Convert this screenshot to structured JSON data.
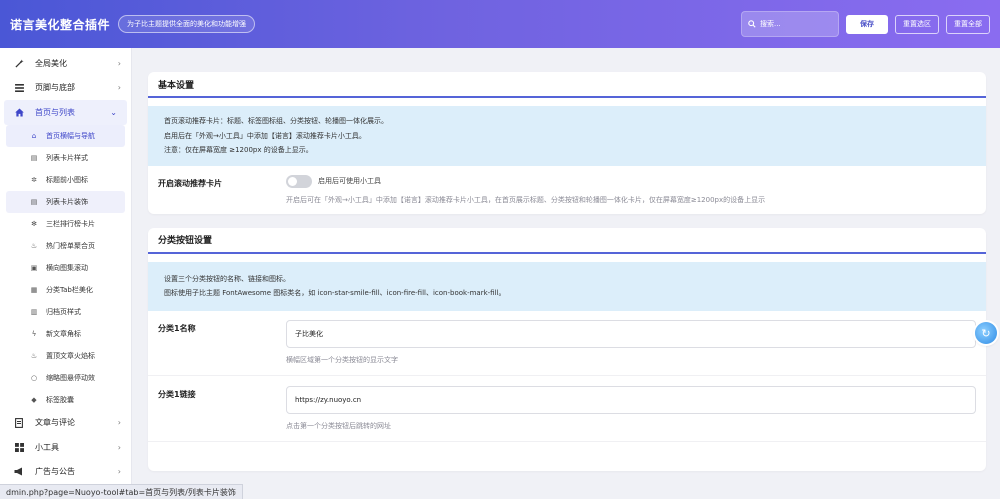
{
  "header": {
    "title": "诺言美化整合插件",
    "subtitle": "为子比主题提供全面的美化和功能增强",
    "search_placeholder": "搜索...",
    "save_label": "保存",
    "reset_section_label": "重置选区",
    "reset_all_label": "重置全部"
  },
  "sidebar": {
    "items": [
      {
        "label": "全局美化",
        "icon": "magic-wand-icon"
      },
      {
        "label": "页脚与底部",
        "icon": "bars-icon"
      },
      {
        "label": "首页与列表",
        "icon": "home-icon"
      },
      {
        "label": "文章与评论",
        "icon": "document-icon"
      },
      {
        "label": "小工具",
        "icon": "grid-icon"
      },
      {
        "label": "广告与公告",
        "icon": "megaphone-icon"
      }
    ],
    "sub_items": [
      {
        "label": "首页横幅与导航",
        "icon": "home-icon"
      },
      {
        "label": "列表卡片样式",
        "icon": "list-icon"
      },
      {
        "label": "标题前小图标",
        "icon": "star-icon"
      },
      {
        "label": "列表卡片装饰",
        "icon": "list-icon"
      },
      {
        "label": "三栏排行榜卡片",
        "icon": "gear-icon"
      },
      {
        "label": "热门榜单聚合页",
        "icon": "fire-icon"
      },
      {
        "label": "横向图集滚动",
        "icon": "image-icon"
      },
      {
        "label": "分类Tab栏美化",
        "icon": "grid-icon"
      },
      {
        "label": "归档页样式",
        "icon": "archive-icon"
      },
      {
        "label": "新文章角标",
        "icon": "bolt-icon"
      },
      {
        "label": "置顶文章火焰标",
        "icon": "fire-icon"
      },
      {
        "label": "缩略图悬停动效",
        "icon": "circle-icon"
      },
      {
        "label": "标签胶囊",
        "icon": "tag-icon"
      }
    ]
  },
  "status_url": "dmin.php?page=Nuoyo-tool#tab=首页与列表/列表卡片装饰",
  "sections": {
    "basic": {
      "title": "基本设置",
      "notice": [
        "首页滚动推荐卡片：标题、标签图标组、分类按钮、轮播图一体化展示。",
        "启用后在「外观→小工具」中添加【诺言】滚动推荐卡片小工具。",
        "注意：仅在屏幕宽度 ≥1200px 的设备上显示。"
      ],
      "toggle_label": "开启滚动推荐卡片",
      "toggle_text": "启用后可使用小工具",
      "toggle_desc": "开启后可在「外观→小工具」中添加【诺言】滚动推荐卡片小工具，在首页展示标题、分类按钮和轮播图一体化卡片，仅在屏幕宽度≥1200px的设备上显示"
    },
    "category": {
      "title": "分类按钮设置",
      "notice": [
        "设置三个分类按钮的名称、链接和图标。",
        "图标使用子比主题 FontAwesome 图标类名，如 icon-star-smile-fill、icon-fire-fill、icon-book-mark-fill。"
      ],
      "name1_label": "分类1名称",
      "name1_value": "子比美化",
      "name1_desc": "横幅区域第一个分类按钮的显示文字",
      "link1_label": "分类1链接",
      "link1_value": "https://zy.nuoyo.cn",
      "link1_desc": "点击第一个分类按钮后跳转的网址"
    }
  }
}
